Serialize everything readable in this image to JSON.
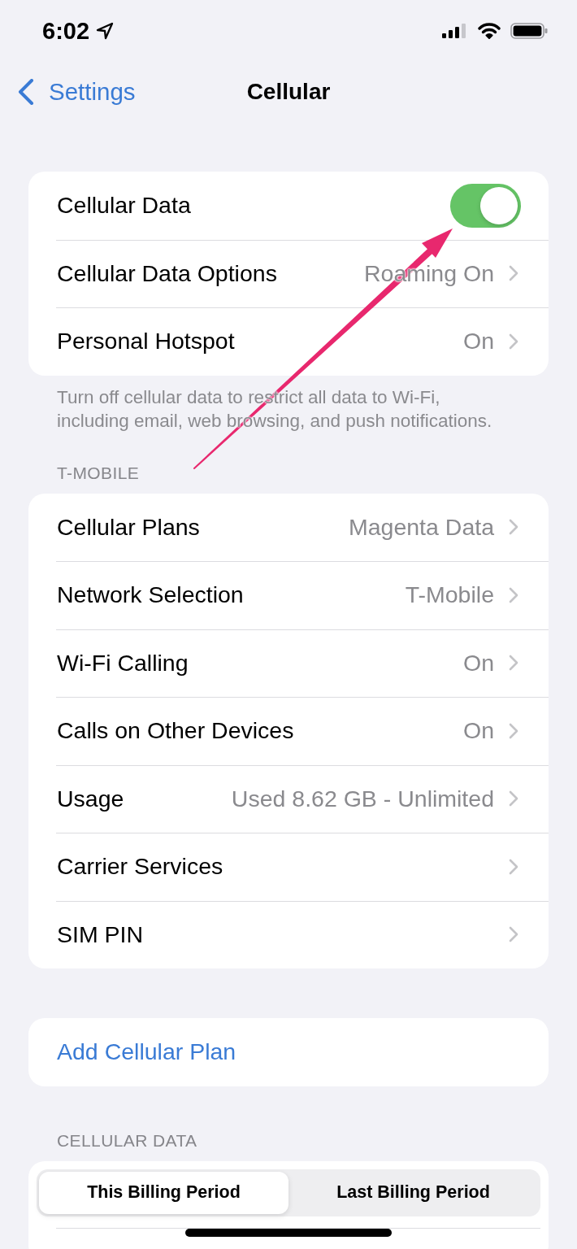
{
  "status_bar": {
    "time": "6:02"
  },
  "nav": {
    "back_label": "Settings",
    "title": "Cellular"
  },
  "sections": [
    {
      "rows": [
        {
          "kind": "toggle",
          "label": "Cellular Data",
          "on": true
        },
        {
          "kind": "link",
          "label": "Cellular Data Options",
          "value": "Roaming On"
        },
        {
          "kind": "link",
          "label": "Personal Hotspot",
          "value": "On"
        }
      ],
      "footer": "Turn off cellular data to restrict all data to Wi-Fi, including email, web browsing, and push notifications."
    },
    {
      "header": "T-MOBILE",
      "rows": [
        {
          "kind": "link",
          "label": "Cellular Plans",
          "value": "Magenta Data"
        },
        {
          "kind": "link",
          "label": "Network Selection",
          "value": "T-Mobile"
        },
        {
          "kind": "link",
          "label": "Wi-Fi Calling",
          "value": "On"
        },
        {
          "kind": "link",
          "label": "Calls on Other Devices",
          "value": "On"
        },
        {
          "kind": "link",
          "label": "Usage",
          "value": "Used 8.62 GB - Unlimited"
        },
        {
          "kind": "link",
          "label": "Carrier Services"
        },
        {
          "kind": "link",
          "label": "SIM PIN"
        }
      ]
    },
    {
      "rows": [
        {
          "kind": "action",
          "label": "Add Cellular Plan"
        }
      ]
    },
    {
      "header": "CELLULAR DATA",
      "segmented": [
        {
          "label": "This Billing Period",
          "selected": true
        },
        {
          "label": "Last Billing Period",
          "selected": false
        }
      ]
    }
  ]
}
